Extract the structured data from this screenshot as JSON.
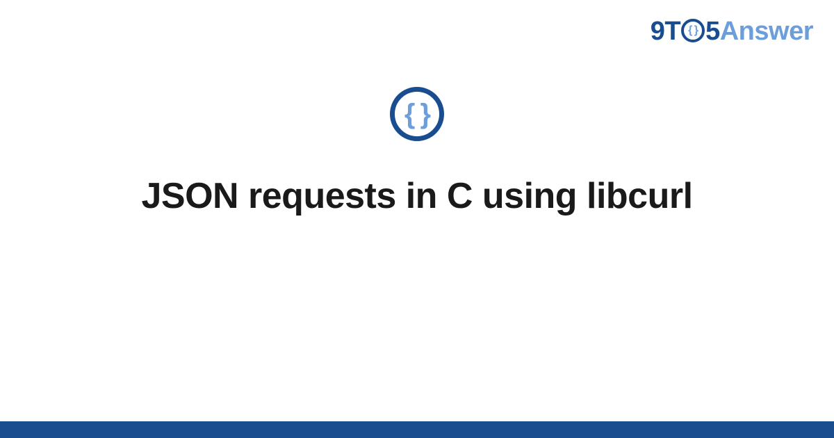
{
  "brand": {
    "part_9t": "9T",
    "o_inner": "{ }",
    "part_5": "5",
    "part_answer": "Answer"
  },
  "topic_badge": {
    "glyph": "{ }"
  },
  "title": "JSON requests in C using libcurl",
  "colors": {
    "primary": "#1a4d8f",
    "accent": "#6b9edb"
  }
}
